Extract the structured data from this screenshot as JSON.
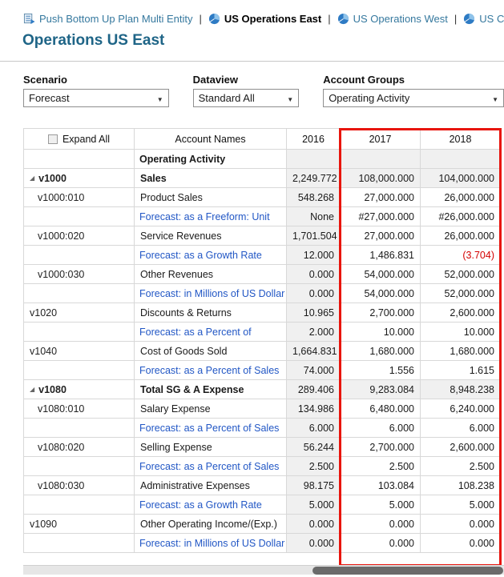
{
  "nav": {
    "separator": "|",
    "tabs": [
      {
        "label": "Push Bottom Up Plan Multi Entity",
        "icon": "task-list-icon",
        "active": false
      },
      {
        "label": "US Operations East",
        "icon": "pie-chart-icon",
        "active": true
      },
      {
        "label": "US Operations West",
        "icon": "pie-chart-icon",
        "active": false
      },
      {
        "label": "US C",
        "icon": "pie-chart-icon",
        "active": false
      }
    ]
  },
  "page": {
    "title": "Operations US East"
  },
  "filters": {
    "scenario": {
      "label": "Scenario",
      "value": "Forecast"
    },
    "dataview": {
      "label": "Dataview",
      "value": "Standard All"
    },
    "account_groups": {
      "label": "Account Groups",
      "value": "Operating Activity"
    }
  },
  "table": {
    "expand_all_label": "Expand All",
    "columns": [
      "Account Names",
      "2016",
      "2017",
      "2018"
    ],
    "highlighted_columns": [
      "2017",
      "2018"
    ],
    "rows": [
      {
        "member": "",
        "name": "Operating Activity",
        "style": "group",
        "expandable": false,
        "values": [
          "",
          "",
          ""
        ]
      },
      {
        "member": "v1000",
        "name": "Sales",
        "style": "parent",
        "expandable": true,
        "values": [
          "2,249.772",
          "108,000.000",
          "104,000.000"
        ]
      },
      {
        "member": "v1000:010",
        "name": "Product Sales",
        "style": "child",
        "expandable": false,
        "values": [
          "548.268",
          "27,000.000",
          "26,000.000"
        ]
      },
      {
        "member": "",
        "name": "Forecast: as a Freeform: Unit",
        "style": "formula",
        "expandable": false,
        "values": [
          "None",
          "#27,000.000",
          "#26,000.000"
        ]
      },
      {
        "member": "v1000:020",
        "name": "Service Revenues",
        "style": "child",
        "expandable": false,
        "values": [
          "1,701.504",
          "27,000.000",
          "26,000.000"
        ]
      },
      {
        "member": "",
        "name": "Forecast: as a Growth Rate",
        "style": "formula",
        "expandable": false,
        "values": [
          "12.000",
          "1,486.831",
          "(3.704)"
        ]
      },
      {
        "member": "v1000:030",
        "name": "Other Revenues",
        "style": "child",
        "expandable": false,
        "values": [
          "0.000",
          "54,000.000",
          "52,000.000"
        ]
      },
      {
        "member": "",
        "name": "Forecast: in Millions of US Dollar",
        "style": "formula",
        "expandable": false,
        "values": [
          "0.000",
          "54,000.000",
          "52,000.000"
        ]
      },
      {
        "member": "v1020",
        "name": "Discounts & Returns",
        "style": "leaf",
        "expandable": false,
        "values": [
          "10.965",
          "2,700.000",
          "2,600.000"
        ]
      },
      {
        "member": "",
        "name": "Forecast: as a Percent of",
        "style": "formula",
        "expandable": false,
        "values": [
          "2.000",
          "10.000",
          "10.000"
        ]
      },
      {
        "member": "v1040",
        "name": "Cost of Goods Sold",
        "style": "leaf",
        "expandable": false,
        "values": [
          "1,664.831",
          "1,680.000",
          "1,680.000"
        ]
      },
      {
        "member": "",
        "name": "Forecast: as a Percent of Sales",
        "style": "formula",
        "expandable": false,
        "values": [
          "74.000",
          "1.556",
          "1.615"
        ]
      },
      {
        "member": "v1080",
        "name": "Total SG & A Expense",
        "style": "parent",
        "expandable": true,
        "values": [
          "289.406",
          "9,283.084",
          "8,948.238"
        ]
      },
      {
        "member": "v1080:010",
        "name": "Salary Expense",
        "style": "child",
        "expandable": false,
        "values": [
          "134.986",
          "6,480.000",
          "6,240.000"
        ]
      },
      {
        "member": "",
        "name": "Forecast: as a Percent of Sales",
        "style": "formula",
        "expandable": false,
        "values": [
          "6.000",
          "6.000",
          "6.000"
        ]
      },
      {
        "member": "v1080:020",
        "name": "Selling Expense",
        "style": "child",
        "expandable": false,
        "values": [
          "56.244",
          "2,700.000",
          "2,600.000"
        ]
      },
      {
        "member": "",
        "name": "Forecast: as a Percent of Sales",
        "style": "formula",
        "expandable": false,
        "values": [
          "2.500",
          "2.500",
          "2.500"
        ]
      },
      {
        "member": "v1080:030",
        "name": "Administrative Expenses",
        "style": "child",
        "expandable": false,
        "values": [
          "98.175",
          "103.084",
          "108.238"
        ]
      },
      {
        "member": "",
        "name": "Forecast: as a Growth Rate",
        "style": "formula",
        "expandable": false,
        "values": [
          "5.000",
          "5.000",
          "5.000"
        ]
      },
      {
        "member": "v1090",
        "name": "Other Operating Income/(Exp.)",
        "style": "leaf",
        "expandable": false,
        "values": [
          "0.000",
          "0.000",
          "0.000"
        ]
      },
      {
        "member": "",
        "name": "Forecast: in Millions of US Dollar",
        "style": "formula",
        "expandable": false,
        "values": [
          "0.000",
          "0.000",
          "0.000"
        ]
      }
    ]
  },
  "colors": {
    "title_teal": "#1f6587",
    "nav_link_teal": "#35789e",
    "link_blue": "#2257c5",
    "negative_red": "#d40000",
    "highlight_border_red": "#e8150d",
    "readonly_cell_gray": "#f0f0f0"
  }
}
